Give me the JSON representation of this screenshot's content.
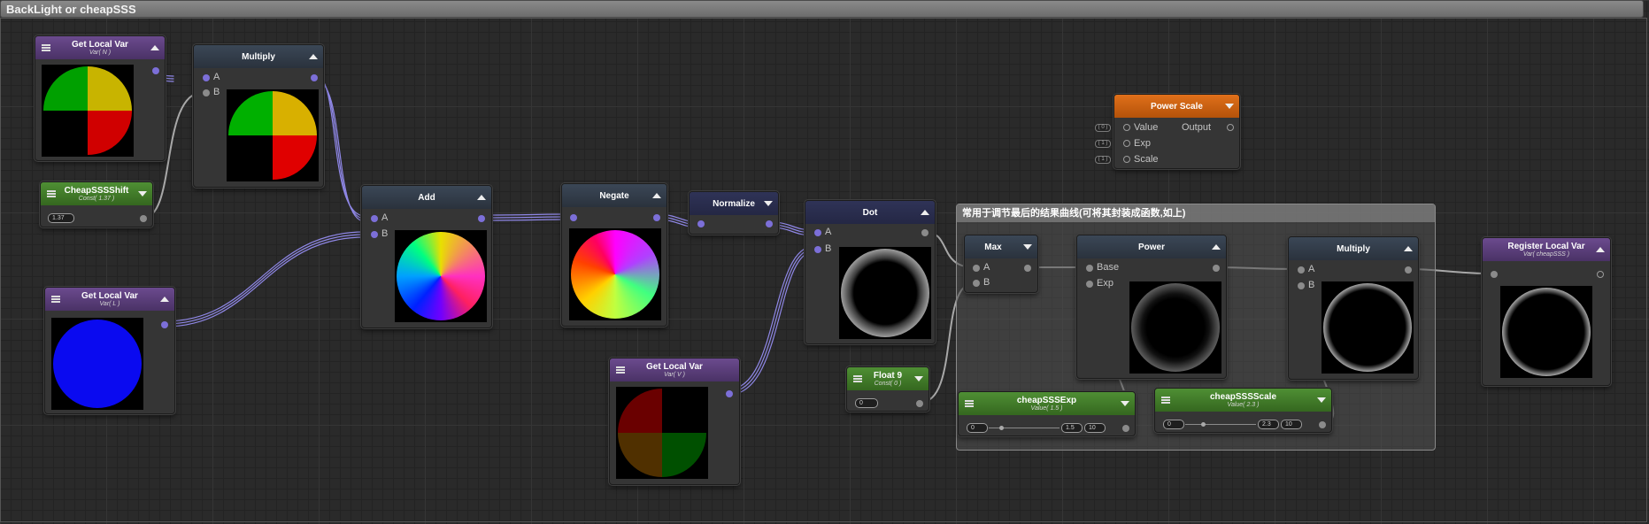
{
  "window_title": "BackLight or cheapSSS",
  "nodes": {
    "get_n": {
      "title": "Get Local Var",
      "subtitle": "Var( N )"
    },
    "multiply1": {
      "title": "Multiply",
      "input_a": "A",
      "input_b": "B"
    },
    "shift": {
      "title": "CheapSSSShift",
      "subtitle": "Const( 1.37 )",
      "value": "1.37"
    },
    "get_l": {
      "title": "Get Local Var",
      "subtitle": "Var( L )"
    },
    "add": {
      "title": "Add",
      "input_a": "A",
      "input_b": "B"
    },
    "negate": {
      "title": "Negate"
    },
    "normalize": {
      "title": "Normalize"
    },
    "dot": {
      "title": "Dot",
      "input_a": "A",
      "input_b": "B"
    },
    "get_v": {
      "title": "Get Local Var",
      "subtitle": "Var( V )"
    },
    "float9": {
      "title": "Float 9",
      "subtitle": "Const( 0 )",
      "value": "0"
    },
    "power_scale": {
      "title": "Power Scale",
      "value_label": "Value",
      "output_label": "Output",
      "exp_label": "Exp",
      "scale_label": "Scale",
      "ext_value": "( 0 )",
      "ext_exp": "( 1 )",
      "ext_scale": "( 1 )"
    },
    "max": {
      "title": "Max",
      "input_a": "A",
      "input_b": "B"
    },
    "power": {
      "title": "Power",
      "input_base": "Base",
      "input_exp": "Exp"
    },
    "multiply2": {
      "title": "Multiply",
      "input_a": "A",
      "input_b": "B"
    },
    "register": {
      "title": "Register Local Var",
      "subtitle": "Var( cheapSSS )"
    },
    "sss_exp": {
      "title": "cheapSSSExp",
      "subtitle": "Value( 1.5 )",
      "min": "0",
      "value": "1.5",
      "max": "10"
    },
    "sss_scale": {
      "title": "cheapSSSScale",
      "subtitle": "Value( 2.3 )",
      "min": "0",
      "value": "2.3",
      "max": "10"
    }
  },
  "group": {
    "title": "常用于调节最后的结果曲线(可将其封装成函数,如上)"
  },
  "colors": {
    "port": "#7c6fd8",
    "wire": "#8f87e6",
    "header_blue": "#2f3a47",
    "header_purple": "#5a3d7a",
    "header_green": "#3f7a28",
    "header_orange": "#d4630f"
  }
}
